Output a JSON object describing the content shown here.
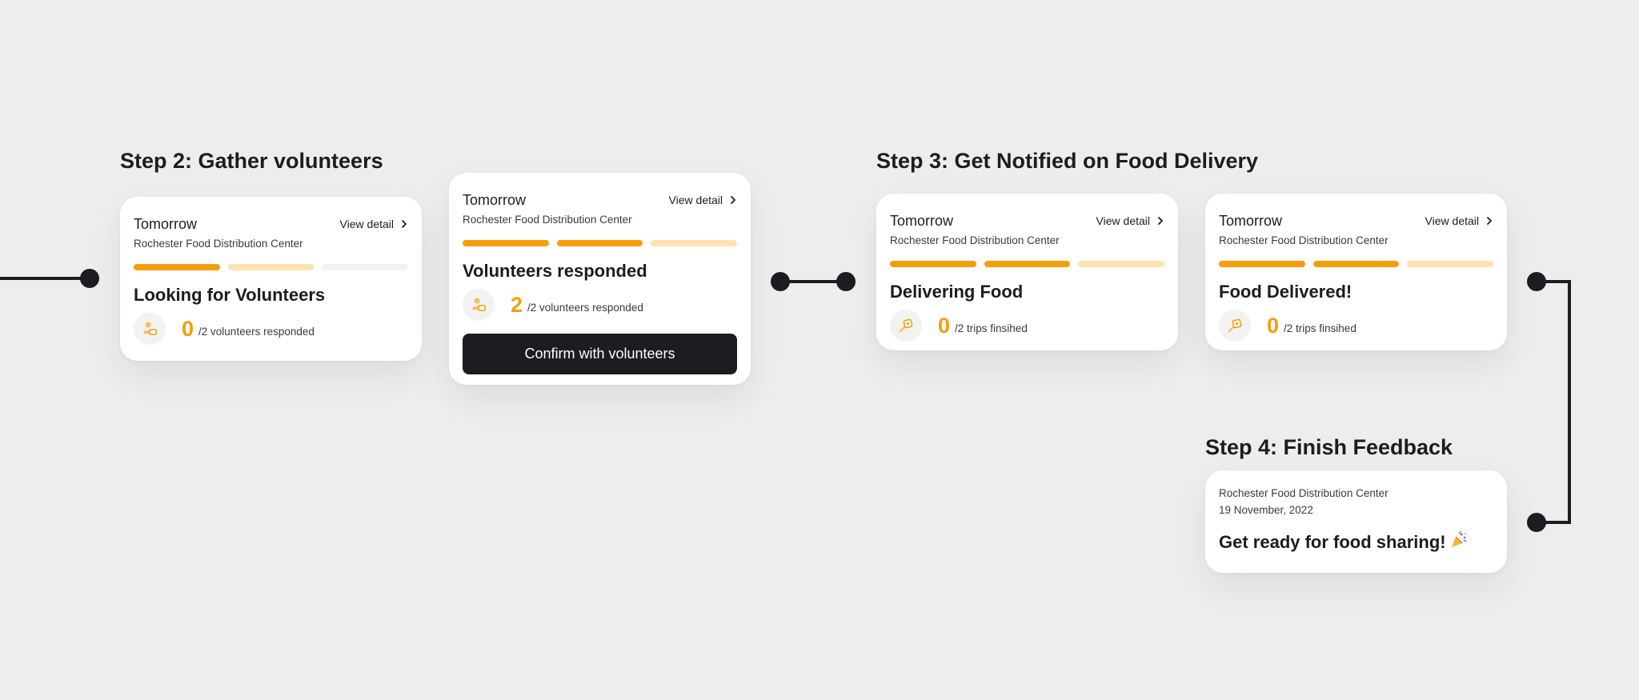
{
  "steps": {
    "step2": {
      "heading": "Step 2: Gather volunteers",
      "card_looking": {
        "when": "Tomorrow",
        "view_detail": "View detail",
        "place": "Rochester Food Distribution Center",
        "progress": [
          "done",
          "next",
          "idle"
        ],
        "status": "Looking for Volunteers",
        "count": "0",
        "total_label": "/2 volunteers responded",
        "icon": "volunteer-icon"
      },
      "card_responded": {
        "when": "Tomorrow",
        "view_detail": "View detail",
        "place": "Rochester Food Distribution Center",
        "progress": [
          "done",
          "done",
          "next"
        ],
        "status": "Volunteers responded",
        "count": "2",
        "total_label": "/2 volunteers responded",
        "icon": "volunteer-icon",
        "confirm_button": "Confirm with volunteers"
      }
    },
    "step3": {
      "heading": "Step 3: Get Notified on Food Delivery",
      "card_delivering": {
        "when": "Tomorrow",
        "view_detail": "View detail",
        "place": "Rochester Food Distribution Center",
        "progress": [
          "done",
          "done",
          "next"
        ],
        "status": "Delivering Food",
        "count": "0",
        "total_label": "/2 trips finsihed",
        "icon": "delivery-icon"
      },
      "card_delivered": {
        "when": "Tomorrow",
        "view_detail": "View detail",
        "place": "Rochester Food Distribution Center",
        "progress": [
          "done",
          "done",
          "next"
        ],
        "status": "Food Delivered!",
        "count": "0",
        "total_label": "/2 trips finsihed",
        "icon": "delivery-icon"
      }
    },
    "step4": {
      "heading": "Step 4: Finish Feedback",
      "card_feedback": {
        "place": "Rochester Food Distribution Center",
        "date": "19 November, 2022",
        "title": "Get ready for food sharing!",
        "emoji": "party-popper-icon"
      }
    }
  },
  "colors": {
    "background": "#ededed",
    "accent": "#f59e0b",
    "accent_light": "#fde3b2",
    "dark": "#1c1c21",
    "card": "#ffffff"
  }
}
